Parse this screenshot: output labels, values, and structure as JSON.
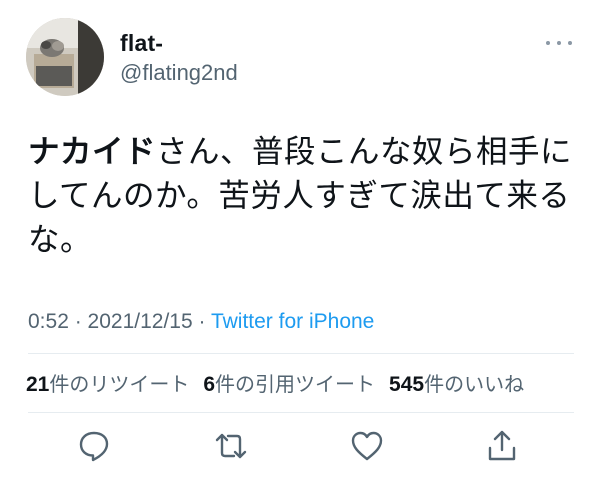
{
  "user": {
    "display_name": "flat-",
    "handle": "@flating2nd"
  },
  "tweet": {
    "mention": "ナカイド",
    "text": "さん、普段こんな奴ら相手にしてんのか。苦労人すぎて涙出て来るな。"
  },
  "meta": {
    "time": "0:52",
    "separator": " · ",
    "date": "2021/12/15",
    "source": "Twitter for iPhone"
  },
  "stats": {
    "retweets": "21",
    "retweets_label": "件のリツイート",
    "quotes": "6",
    "quotes_label": "件の引用ツイート",
    "likes": "545",
    "likes_label": "件のいいね"
  },
  "actions": {
    "reply_icon": "reply-icon",
    "retweet_icon": "retweet-icon",
    "like_icon": "heart-icon",
    "share_icon": "share-icon"
  },
  "colors": {
    "accent": "#1d9bf0",
    "secondary": "#536471"
  }
}
